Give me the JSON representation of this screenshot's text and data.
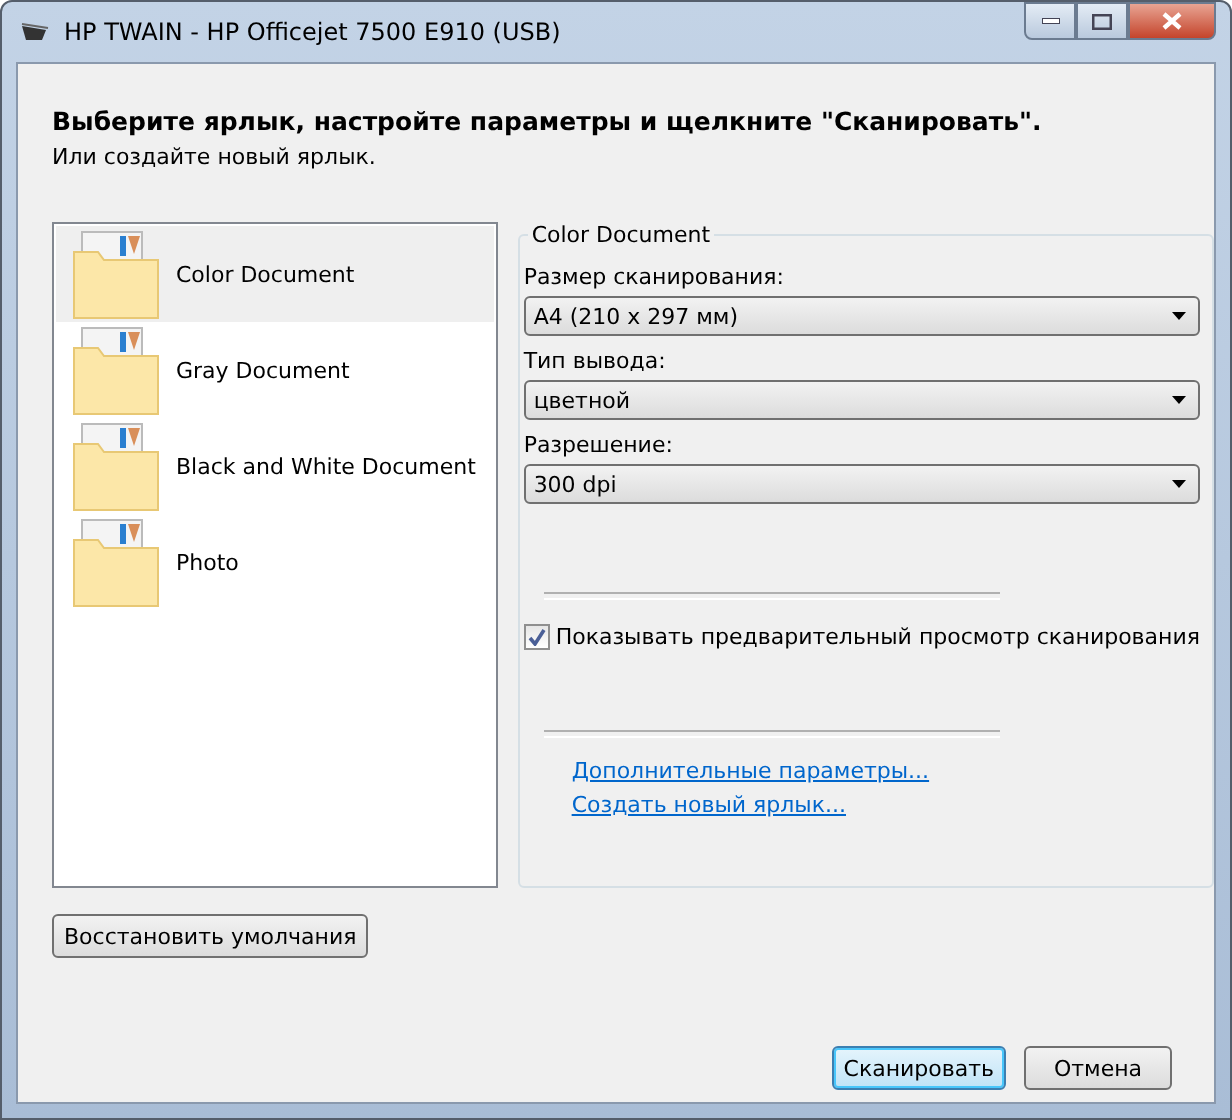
{
  "window": {
    "title": "HP TWAIN - HP Officejet 7500 E910 (USB)"
  },
  "heading": "Выберите ярлык, настройте параметры и щелкните \"Сканировать\".",
  "subheading": "Или создайте новый ярлык.",
  "shortcuts": [
    {
      "label": "Color Document",
      "selected": true
    },
    {
      "label": "Gray Document",
      "selected": false
    },
    {
      "label": "Black and White Document",
      "selected": false
    },
    {
      "label": "Photo",
      "selected": false
    }
  ],
  "settings": {
    "title": "Color Document",
    "fields": [
      {
        "label": "Размер сканирования:",
        "value": "A4 (210 x 297 мм)"
      },
      {
        "label": "Тип вывода:",
        "value": "цветной"
      },
      {
        "label": "Разрешение:",
        "value": "300 dpi"
      }
    ],
    "preview": {
      "label": "Показывать предварительный просмотр сканирования",
      "checked": true
    },
    "links": [
      "Дополнительные параметры...",
      "Создать новый ярлык..."
    ]
  },
  "restore_button": "Восстановить умолчания",
  "buttons": [
    {
      "label": "Сканировать",
      "default": true
    },
    {
      "label": "Отмена",
      "default": false
    }
  ]
}
